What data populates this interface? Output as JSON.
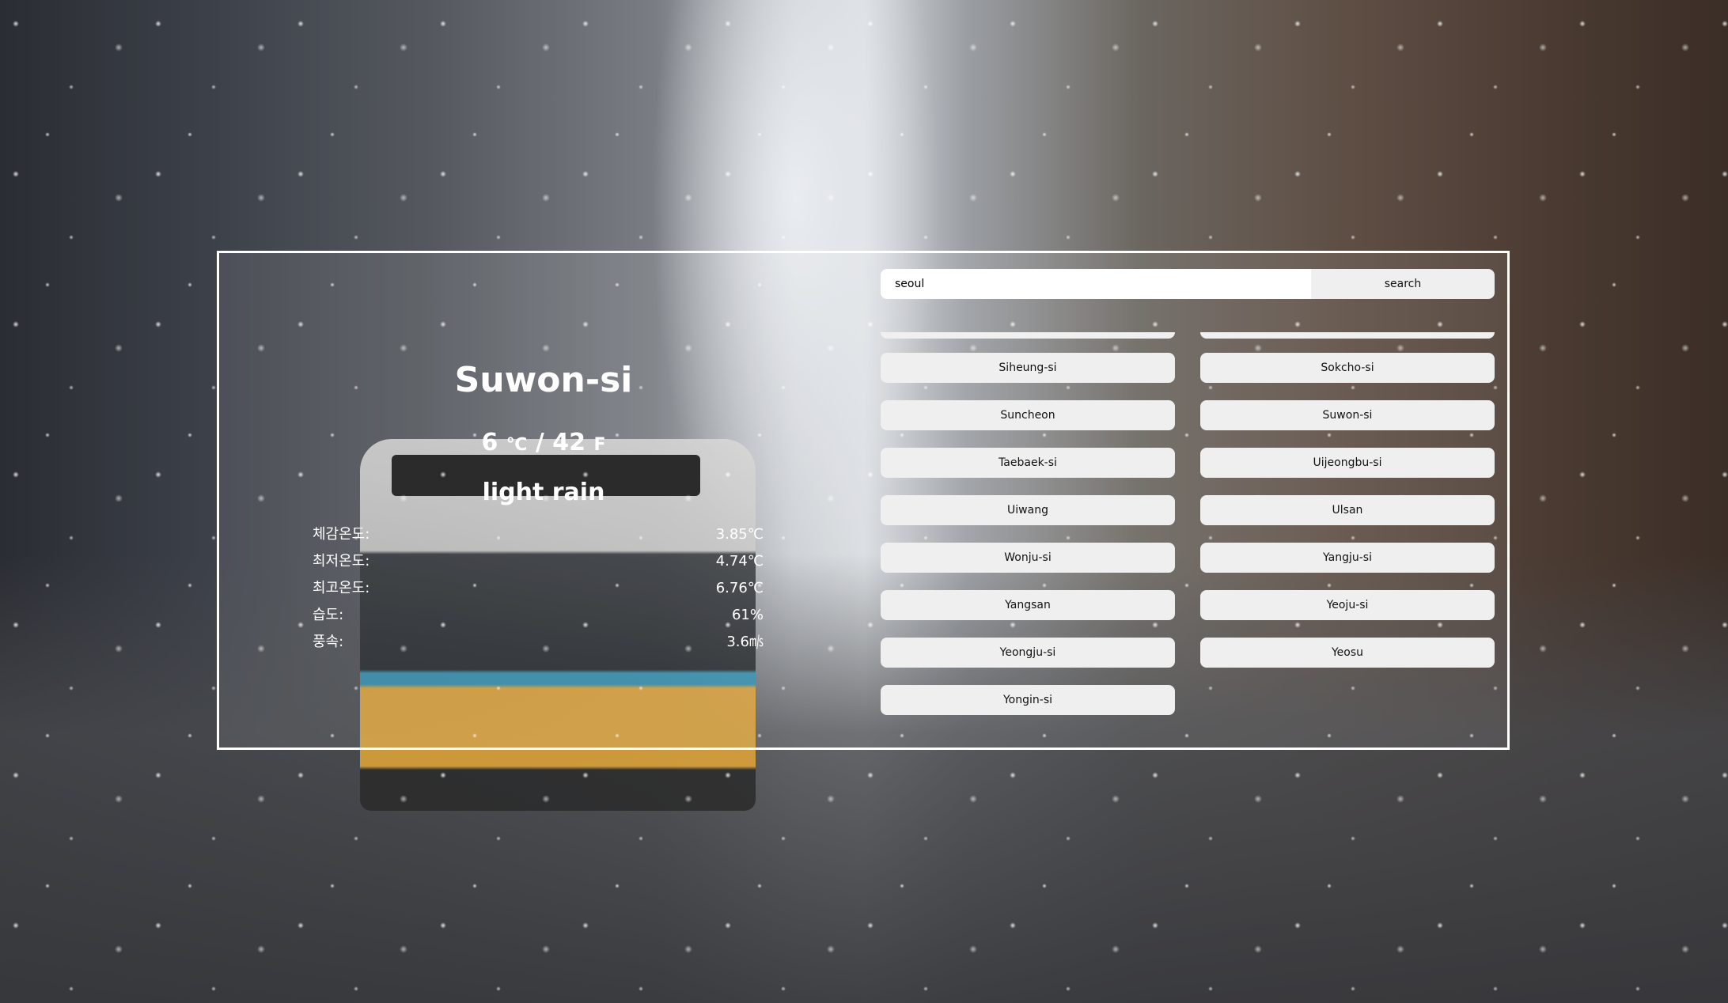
{
  "current": {
    "city": "Suwon-si",
    "temp_c": "6",
    "unit_c": "℃",
    "separator": "/",
    "temp_f": "42",
    "unit_f": "F",
    "description": "light rain"
  },
  "details": [
    {
      "label": "체감온도:",
      "value": "3.85℃"
    },
    {
      "label": "최저온도:",
      "value": "4.74℃"
    },
    {
      "label": "최고온도:",
      "value": "6.76℃"
    },
    {
      "label": "습도:",
      "value": "61%"
    },
    {
      "label": "풍속:",
      "value": "3.6㎧"
    }
  ],
  "search": {
    "value": "seoul",
    "button_label": "search"
  },
  "cities": [
    "Siheung-si",
    "Sokcho-si",
    "Suncheon",
    "Suwon-si",
    "Taebaek-si",
    "Uijeongbu-si",
    "Uiwang",
    "Ulsan",
    "Wonju-si",
    "Yangju-si",
    "Yangsan",
    "Yeoju-si",
    "Yeongju-si",
    "Yeosu",
    "Yongin-si"
  ]
}
